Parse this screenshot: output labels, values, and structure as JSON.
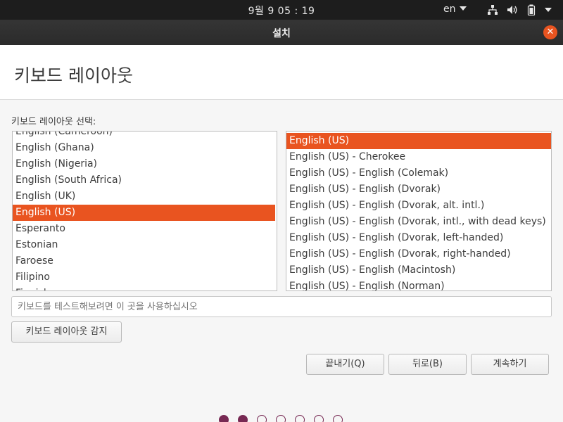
{
  "topbar": {
    "clock": "9월 9  05 : 19",
    "language": "en",
    "icons": [
      "network-icon",
      "volume-icon",
      "battery-icon",
      "system-menu-caret"
    ]
  },
  "window": {
    "title": "설치",
    "close_icon": "close-icon"
  },
  "header": {
    "title": "키보드 레이아웃"
  },
  "layouts": {
    "label": "키보드 레이아웃 선택:",
    "left_items": [
      "English (Cameroon)",
      "English (Ghana)",
      "English (Nigeria)",
      "English (South Africa)",
      "English (UK)",
      "English (US)",
      "Esperanto",
      "Estonian",
      "Faroese",
      "Filipino",
      "Finnish"
    ],
    "left_selected": "English (US)",
    "right_items": [
      "English (US)",
      "English (US) - Cherokee",
      "English (US) - English (Colemak)",
      "English (US) - English (Dvorak)",
      "English (US) - English (Dvorak, alt. intl.)",
      "English (US) - English (Dvorak, intl., with dead keys)",
      "English (US) - English (Dvorak, left-handed)",
      "English (US) - English (Dvorak, right-handed)",
      "English (US) - English (Macintosh)",
      "English (US) - English (Norman)"
    ],
    "right_selected": "English (US)"
  },
  "test": {
    "placeholder": "키보드를 테스트해보려면 이 곳을 사용하십시오",
    "value": ""
  },
  "buttons": {
    "detect": "키보드 레이아웃 감지",
    "quit": "끝내기(Q)",
    "back": "뒤로(B)",
    "continue": "계속하기"
  },
  "progress": {
    "total_steps": 7,
    "completed_steps": 2
  },
  "colors": {
    "accent": "#e95420",
    "progress": "#772953"
  }
}
